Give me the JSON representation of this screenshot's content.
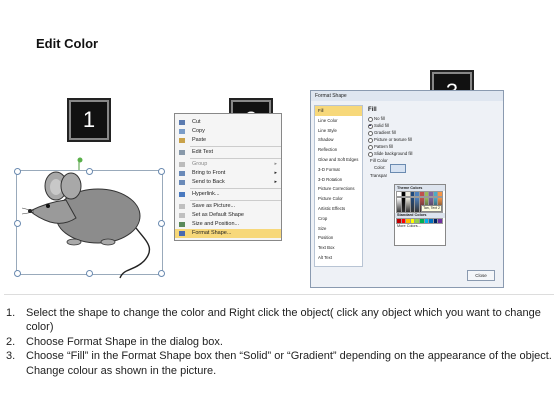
{
  "title": "Edit Color",
  "badges": [
    "1",
    "2",
    "3"
  ],
  "context_menu": {
    "items": [
      {
        "label": "Cut",
        "icon": "scissors-icon"
      },
      {
        "label": "Copy",
        "icon": "copy-icon"
      },
      {
        "label": "Paste",
        "icon": "paste-icon"
      },
      {
        "label": "Edit Text",
        "icon": "text-icon"
      },
      {
        "label": "Group",
        "icon": "group-icon",
        "submenu": true
      },
      {
        "label": "Bring to Front",
        "icon": "bring-front-icon",
        "submenu": true
      },
      {
        "label": "Send to Back",
        "icon": "send-back-icon",
        "submenu": true
      },
      {
        "label": "Hyperlink...",
        "icon": "hyperlink-icon"
      },
      {
        "label": "Save as Picture...",
        "icon": "save-picture-icon"
      },
      {
        "label": "Set as Default Shape",
        "icon": "default-shape-icon"
      },
      {
        "label": "Size and Position...",
        "icon": "size-icon"
      },
      {
        "label": "Format Shape...",
        "icon": "format-shape-icon",
        "highlighted": true
      }
    ]
  },
  "format_dialog": {
    "title": "Format Shape",
    "nav_items": [
      "Fill",
      "Line Color",
      "Line Style",
      "Shadow",
      "Reflection",
      "Glow and Soft Edges",
      "3-D Format",
      "3-D Rotation",
      "Picture Corrections",
      "Picture Color",
      "Artistic Effects",
      "Crop",
      "Size",
      "Position",
      "Text Box",
      "Alt Text"
    ],
    "section_title": "Fill",
    "options": [
      "No fill",
      "Solid fill",
      "Gradient fill",
      "Picture or texture fill",
      "Pattern fill",
      "Slide background fill"
    ],
    "subheading": "Fill Color",
    "color_label": "Color:",
    "transparency_label": "Transpar",
    "theme_colors_label": "Theme Colors",
    "standard_colors_label": "Standard Colors",
    "more_colors_label": "More Colors...",
    "tooltip": "Tan, Text 2",
    "close_label": "Close"
  },
  "instructions": [
    {
      "num": "1.",
      "text": "Select the shape to change the color and Right click the object( click any object which you want to change color)"
    },
    {
      "num": "2.",
      "text": "Choose Format Shape in the dialog box."
    },
    {
      "num": "3.",
      "text": "Choose “Fill” in the Format Shape box then “Solid” or “Gradient” depending on the appearance of the object. Change colour as shown in the picture."
    }
  ],
  "colors": {
    "badge_bg": "#111111",
    "highlight": "#f7d87a",
    "mouse_body": "#8c8c8c",
    "theme_row": [
      "#ffffff",
      "#000000",
      "#eeece1",
      "#1f497d",
      "#4f81bd",
      "#c0504d",
      "#9bbb59",
      "#8064a2",
      "#4bacc6",
      "#f79646"
    ],
    "standard_row": [
      "#c00000",
      "#ff0000",
      "#ffc000",
      "#ffff00",
      "#92d050",
      "#00b050",
      "#00b0f0",
      "#0070c0",
      "#002060",
      "#7030a0"
    ]
  }
}
